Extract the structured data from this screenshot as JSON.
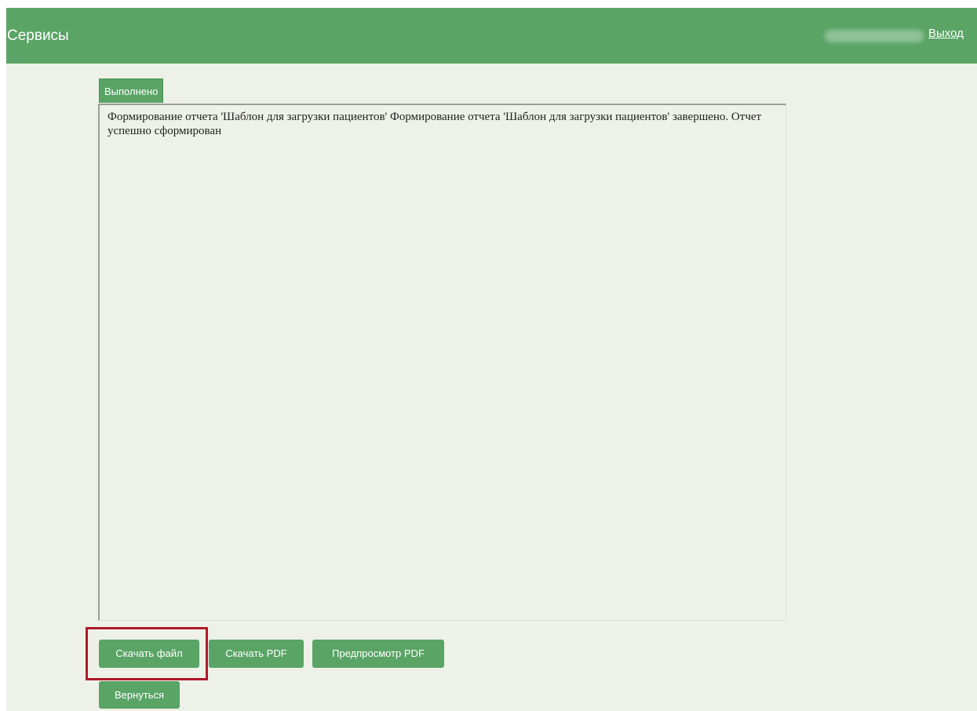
{
  "header": {
    "title": "Сервисы",
    "logout_label": "Выход"
  },
  "tab": {
    "label": "Выполнено"
  },
  "report": {
    "message": "Формирование отчета 'Шаблон для загрузки пациентов' Формирование отчета 'Шаблон для загрузки пациентов' завершено. Отчет успешно сформирован"
  },
  "buttons": {
    "download_file": "Скачать файл",
    "download_pdf": "Скачать PDF",
    "preview_pdf": "Предпросмотр PDF",
    "back": "Вернуться"
  },
  "colors": {
    "header_bg": "#5aa466",
    "button_bg": "#5aa466",
    "highlight": "#b0192b",
    "page_bg": "#eef1e8"
  }
}
